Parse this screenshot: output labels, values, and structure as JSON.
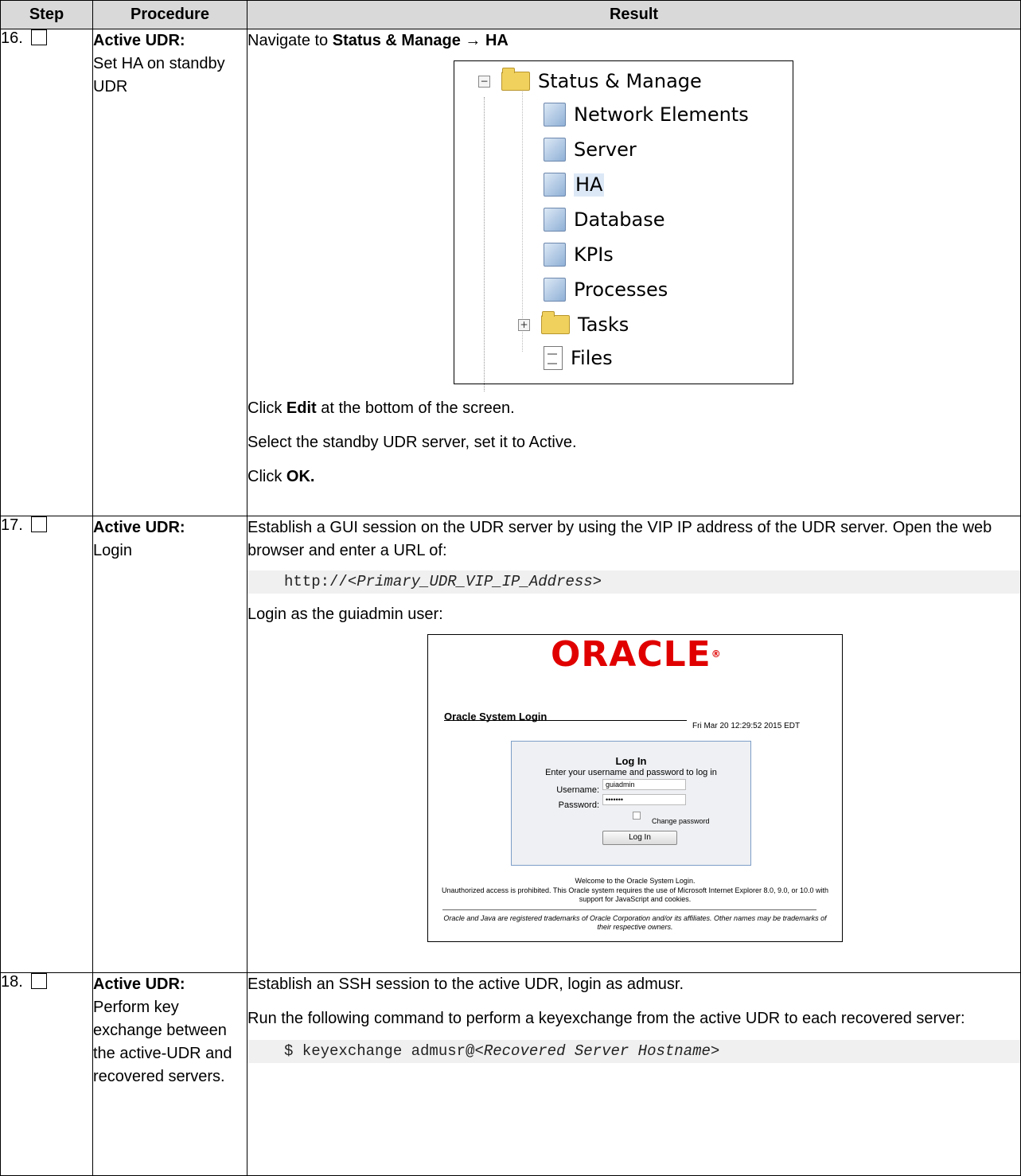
{
  "headers": {
    "step": "Step",
    "procedure": "Procedure",
    "result": "Result"
  },
  "rows": [
    {
      "step": "16.",
      "proc_title": "Active UDR:",
      "proc_desc": "Set HA on standby UDR",
      "nav_prefix": "Navigate to ",
      "nav_bold": "Status & Manage → HA",
      "tree": {
        "root": "Status & Manage",
        "items": [
          "Network Elements",
          "Server",
          "HA",
          "Database",
          "KPIs",
          "Processes"
        ],
        "tasks": "Tasks",
        "files": "Files"
      },
      "edit_prefix": "Click ",
      "edit_bold": "Edit",
      "edit_suffix": " at the bottom of the screen.",
      "select_text": "Select the standby UDR server, set it to Active.",
      "ok_prefix": "Click ",
      "ok_bold": "OK."
    },
    {
      "step": "17.",
      "proc_title": "Active UDR:",
      "proc_desc": "Login",
      "establish_text": "Establish a GUI session on the UDR server by using the VIP IP address of the UDR server. Open the web browser and enter a URL of:",
      "url_prefix": "http://",
      "url_italic": "<Primary_UDR_VIP_IP_Address>",
      "login_as": "Login as the guiadmin user:",
      "login": {
        "logo": "ORACLE",
        "logo_mark": "®",
        "system_title": "Oracle System Login",
        "date": "Fri Mar 20 12:29:52 2015 EDT",
        "box_title": "Log In",
        "box_subtitle": "Enter your username and password to log in",
        "username_label": "Username:",
        "username_value": "guiadmin",
        "password_label": "Password:",
        "password_value": "•••••••",
        "change_password": "Change password",
        "button": "Log In",
        "welcome": "Welcome to the Oracle System Login.",
        "unauthorized": "Unauthorized access is prohibited. This Oracle system requires the use of Microsoft Internet Explorer 8.0, 9.0, or 10.0 with support for JavaScript and cookies.",
        "trademark": "Oracle and Java are registered trademarks of Oracle Corporation and/or its affiliates. Other names may be trademarks of their respective owners."
      }
    },
    {
      "step": "18.",
      "proc_title": "Active UDR:",
      "proc_desc": "Perform key exchange between the active-UDR and recovered servers.",
      "ssh_text": "Establish an SSH session to the active UDR, login as admusr.",
      "run_text": "Run the following command to perform a keyexchange from the active UDR to each recovered server:",
      "cmd_prefix": "$ keyexchange admusr@",
      "cmd_italic": "<Recovered Server Hostname>"
    }
  ]
}
